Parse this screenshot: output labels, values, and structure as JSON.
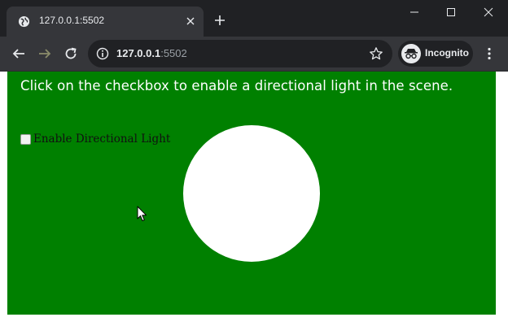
{
  "browser": {
    "tab_title": "127.0.0.1:5502",
    "url_host": "127.0.0.1",
    "url_port": ":5502",
    "profile_label": "Incognito"
  },
  "page": {
    "instruction": "Click on the checkbox to enable a directional light in the scene.",
    "checkbox_label": "Enable Directional Light",
    "checkbox_checked": false
  },
  "colors": {
    "scene_background": "#008000",
    "sphere": "#ffffff",
    "chrome_dark": "#202124",
    "chrome_toolbar": "#35363a"
  },
  "icons": [
    "globe-icon",
    "close-icon",
    "plus-icon",
    "minimize-icon",
    "maximize-icon",
    "close-window-icon",
    "back-arrow-icon",
    "forward-arrow-icon",
    "reload-icon",
    "info-icon",
    "star-icon",
    "incognito-icon",
    "kebab-menu-icon",
    "mouse-cursor-icon"
  ]
}
